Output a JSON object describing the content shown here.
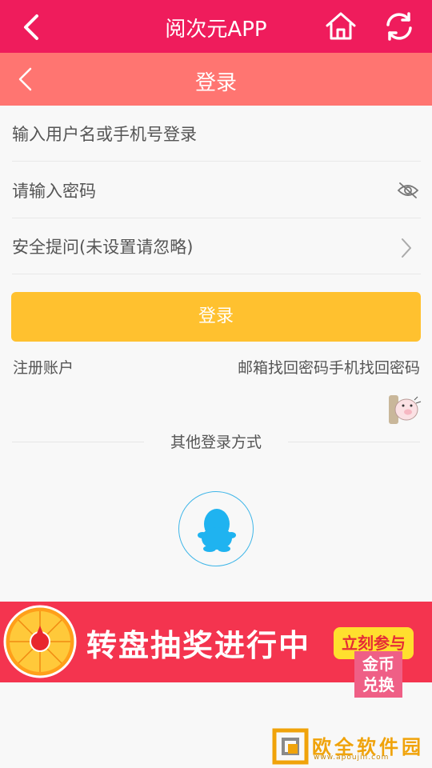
{
  "topbar": {
    "title": "阅次元APP"
  },
  "subbar": {
    "title": "登录"
  },
  "form": {
    "username_placeholder": "输入用户名或手机号登录",
    "password_placeholder": "请输入密码",
    "security_question_placeholder": "安全提问(未设置请忽略)",
    "login_button": "登录"
  },
  "links": {
    "register": "注册账户",
    "recover": "邮箱找回密码手机找回密码"
  },
  "other_login": {
    "divider_text": "其他登录方式"
  },
  "banner": {
    "headline": "转盘抽奖进行中",
    "cta": "立刻参与",
    "coin_exchange": [
      "金币",
      "兑换"
    ]
  },
  "watermark": {
    "name": "欧全软件园",
    "url": "www.apoujin.com"
  },
  "colors": {
    "primary": "#ef1c5c",
    "subbar": "#ff7571",
    "button": "#ffc12f",
    "qq": "#1fb3f0"
  }
}
